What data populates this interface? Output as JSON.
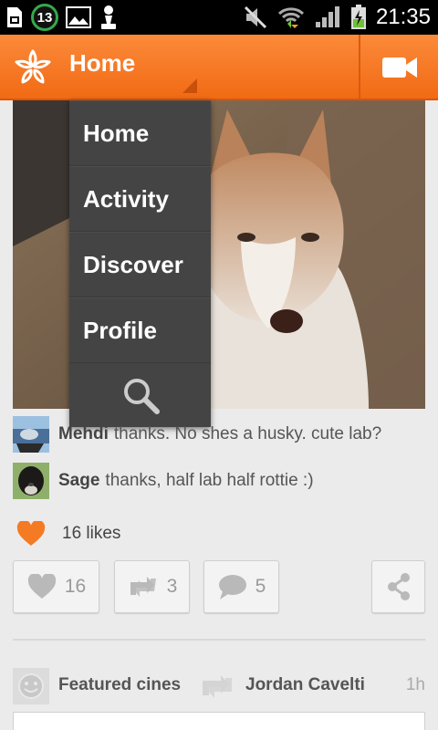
{
  "status_bar": {
    "notification_count": "13",
    "time": "21:35",
    "icons": [
      "sim-card-icon",
      "notification-count-badge",
      "gallery-icon",
      "chess-pawn-icon",
      "mute-icon",
      "wifi-icon",
      "signal-icon",
      "battery-charging-icon"
    ]
  },
  "action_bar": {
    "title": "Home",
    "logo_icon": "viddy-star-logo",
    "video_icon": "video-camera-icon"
  },
  "menu": {
    "items": [
      {
        "label": "Home"
      },
      {
        "label": "Activity"
      },
      {
        "label": "Discover"
      },
      {
        "label": "Profile"
      }
    ],
    "search_icon": "search-icon"
  },
  "comments": [
    {
      "name": "Mehdi",
      "text": "thanks. No shes a husky. cute lab?"
    },
    {
      "name": "Sage",
      "text": "thanks, half lab half rottie :)"
    }
  ],
  "likes": {
    "text": "16 likes"
  },
  "actions": {
    "like_count": "16",
    "repost_count": "3",
    "comment_count": "5"
  },
  "feed_item": {
    "user": "Featured cines",
    "reposted_by": "Jordan Cavelti",
    "time": "1h"
  },
  "colors": {
    "accent": "#f47a24",
    "heart": "#f47a24",
    "menu_bg": "#444444"
  }
}
